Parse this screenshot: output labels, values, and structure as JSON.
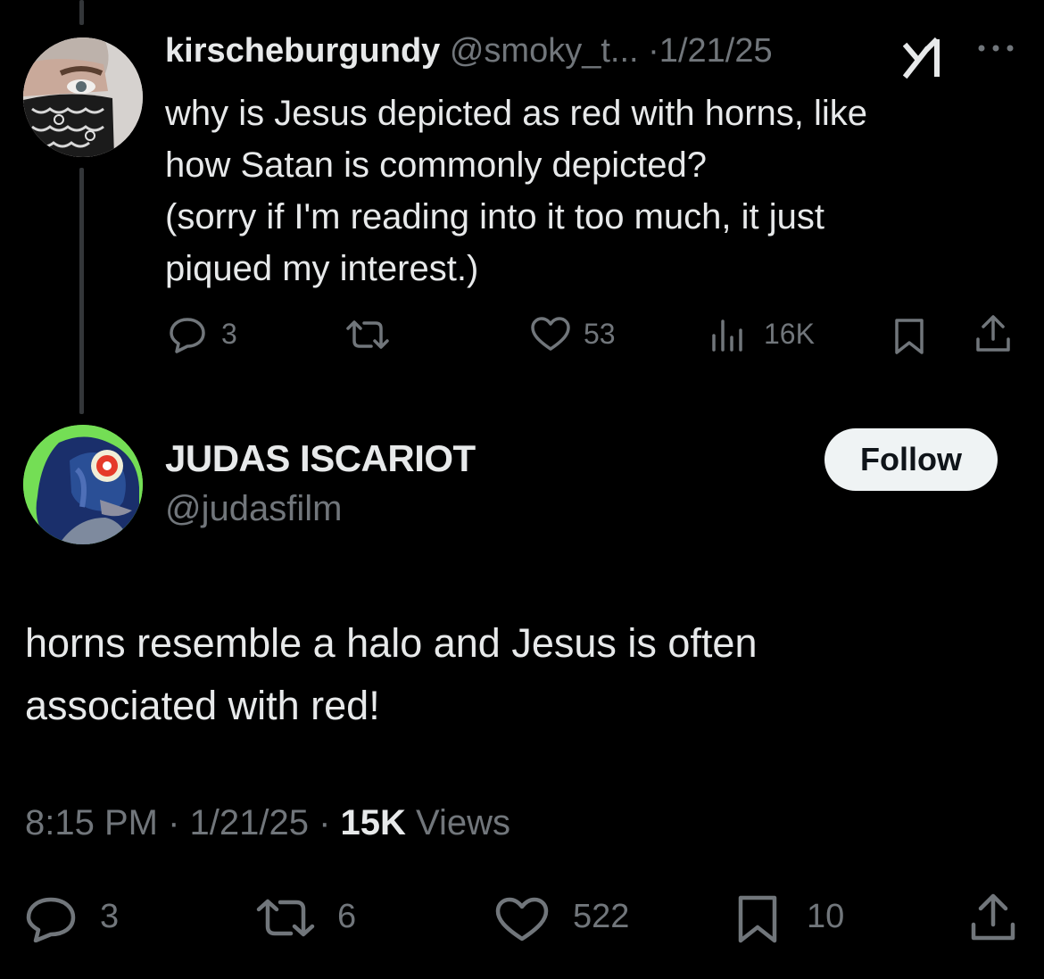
{
  "reply_to": {
    "display_name": "kirscheburgundy",
    "handle": "@smoky_t...",
    "date": "·1/21/25",
    "text_lines": [
      "why is Jesus depicted as red with horns, like",
      "how Satan is commonly depicted?",
      "(sorry if I'm reading into it too much, it just",
      "piqued my interest.)"
    ],
    "actions": {
      "replies": "3",
      "likes": "53",
      "views": "16K"
    }
  },
  "main_tweet": {
    "display_name": "JUDAS ISCARIOT",
    "handle": "@judasfilm",
    "follow_label": "Follow",
    "text_lines": [
      "horns resemble a halo and Jesus is often",
      "associated with red!"
    ],
    "meta": {
      "time": "8:15 PM · 1/21/25 · ",
      "views_count": "15K",
      "views_label": " Views"
    },
    "actions": {
      "replies": "3",
      "reposts": "6",
      "likes": "522",
      "bookmarks": "10"
    }
  },
  "colors": {
    "background": "#000000",
    "text_primary": "#e7e9ea",
    "text_secondary": "#71767b",
    "follow_button_bg": "#eff3f4"
  }
}
